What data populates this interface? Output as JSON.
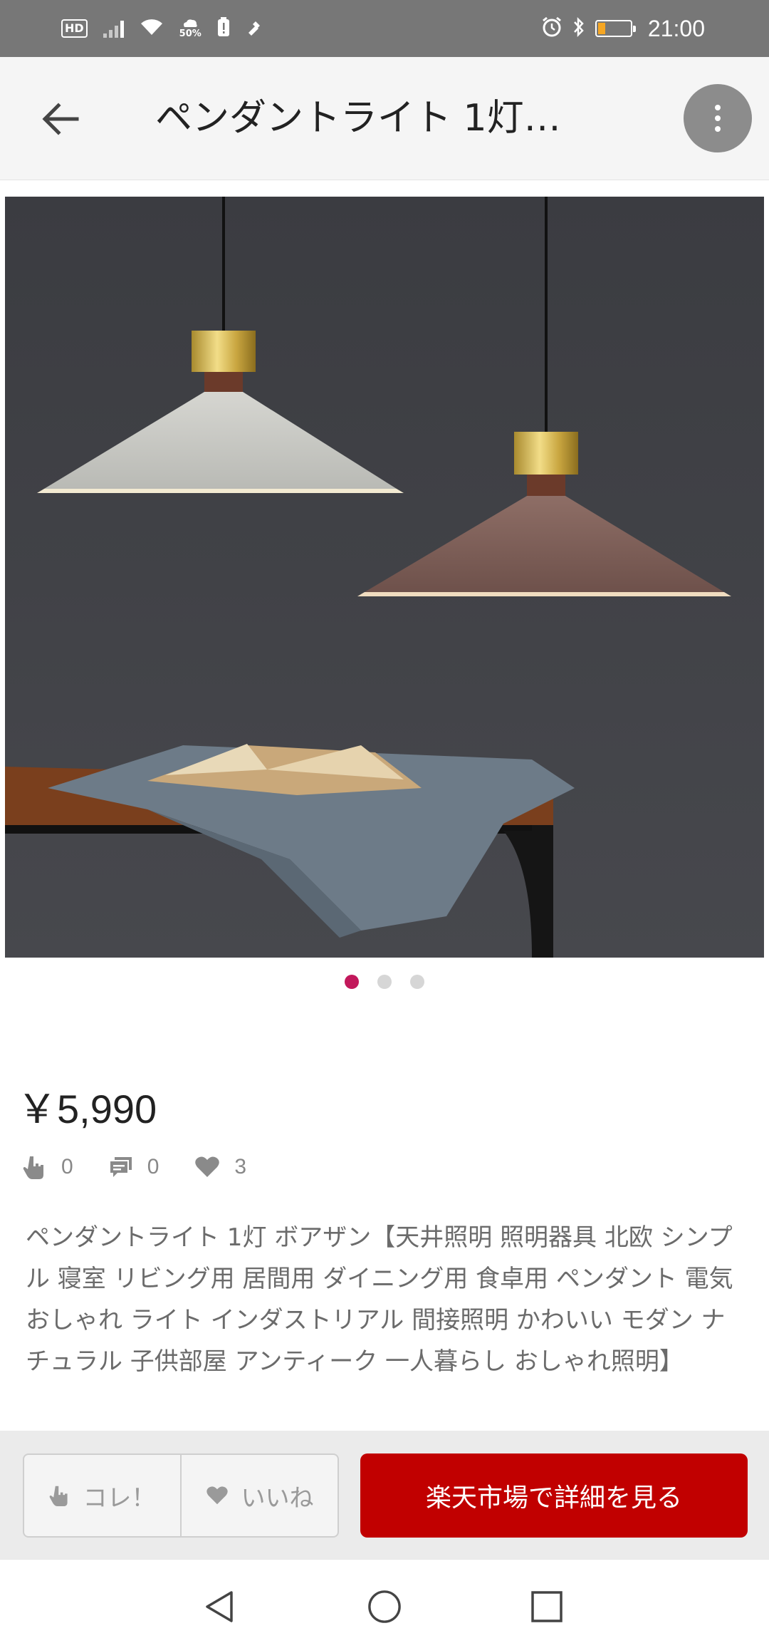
{
  "status_bar": {
    "hd": "HD",
    "battery_saver": "50%",
    "time": "21:00"
  },
  "header": {
    "title": "ペンダントライト 1灯…"
  },
  "carousel": {
    "count": 3,
    "active_index": 0,
    "active_color": "#c2185b"
  },
  "product": {
    "price": "￥5,990",
    "stats": {
      "kore_count": "0",
      "comment_count": "0",
      "like_count": "3"
    },
    "description": "ペンダントライト 1灯 ボアザン【天井照明 照明器具 北欧 シンプル 寝室 リビング用 居間用 ダイニング用 食卓用 ペンダント 電気 おしゃれ ライト インダストリアル 間接照明 かわいい モダン ナチュラル 子供部屋 アンティーク 一人暮らし おしゃれ照明】"
  },
  "actions": {
    "kore_label": "コレ！",
    "like_label": "いいね",
    "detail_label": "楽天市場で詳細を見る",
    "detail_color": "#c10000"
  },
  "icons": {
    "back": "arrow-left-icon",
    "more": "more-vertical-icon",
    "kore": "pointing-hand-icon",
    "comment": "comment-icon",
    "like": "heart-icon"
  }
}
